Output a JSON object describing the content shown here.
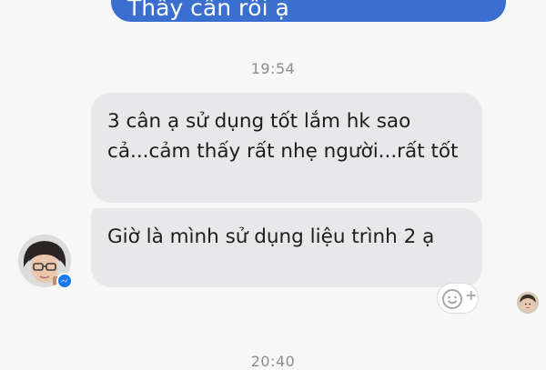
{
  "conversation": {
    "outgoing_partial": "Thấy cân rồi ạ",
    "timestamps": [
      "19:54",
      "20:40"
    ],
    "incoming": [
      "3 cân ạ sử dụng tốt lắm hk sao cả...cảm thấy rất nhẹ người...rất tốt",
      "Giờ là mình sử dụng liệu trình 2 ạ"
    ]
  },
  "icons": {
    "badge": "messenger-icon",
    "reaction": "smiley-add-icon",
    "receipt": "seen-avatar-icon"
  },
  "colors": {
    "outgoing_bubble": "#3a6fcf",
    "incoming_bubble": "#e8e8ea",
    "messenger_badge": "#1877f2",
    "background": "#f7f7f7"
  }
}
